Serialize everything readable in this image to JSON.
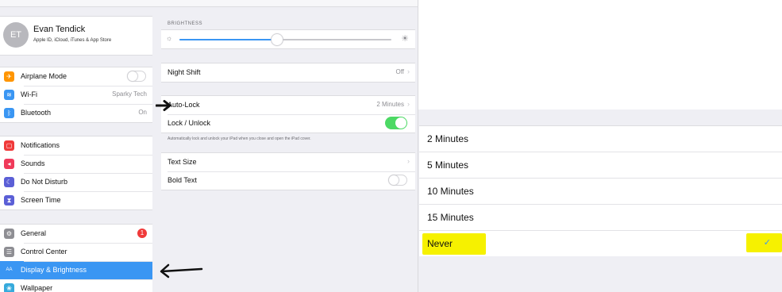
{
  "profile": {
    "initials": "ET",
    "name": "Evan Tendick",
    "subtitle": "Apple ID, iCloud, iTunes & App Store"
  },
  "sidebar": {
    "group1": [
      {
        "label": "Airplane Mode",
        "icon": "airplane-icon",
        "color": "#ff9500",
        "glyph": "✈",
        "control": "toggle-off"
      },
      {
        "label": "Wi-Fi",
        "icon": "wifi-icon",
        "color": "#3a96f3",
        "glyph": "≋",
        "value": "Sparky Tech"
      },
      {
        "label": "Bluetooth",
        "icon": "bluetooth-icon",
        "color": "#3a96f3",
        "glyph": "ᛒ",
        "value": "On"
      }
    ],
    "group2": [
      {
        "label": "Notifications",
        "icon": "notifications-icon",
        "color": "#f03a3a",
        "glyph": "▢"
      },
      {
        "label": "Sounds",
        "icon": "sounds-icon",
        "color": "#f03a5a",
        "glyph": "◂"
      },
      {
        "label": "Do Not Disturb",
        "icon": "moon-icon",
        "color": "#5b5fd6",
        "glyph": "☾"
      },
      {
        "label": "Screen Time",
        "icon": "hourglass-icon",
        "color": "#5b5fd6",
        "glyph": "⧗"
      }
    ],
    "group3": [
      {
        "label": "General",
        "icon": "gear-icon",
        "color": "#8e8e93",
        "glyph": "⚙",
        "badge": "1"
      },
      {
        "label": "Control Center",
        "icon": "control-center-icon",
        "color": "#8e8e93",
        "glyph": "☰"
      },
      {
        "label": "Display & Brightness",
        "icon": "display-icon",
        "color": "#3a96f3",
        "glyph": "AA",
        "selected": true
      },
      {
        "label": "Wallpaper",
        "icon": "wallpaper-icon",
        "color": "#36aadc",
        "glyph": "❀"
      }
    ]
  },
  "pane": {
    "brightness_header": "BRIGHTNESS",
    "brightness_level": 0.46,
    "night_shift_label": "Night Shift",
    "night_shift_value": "Off",
    "auto_lock_label": "Auto-Lock",
    "auto_lock_value": "2 Minutes",
    "lock_unlock_label": "Lock / Unlock",
    "lock_unlock_on": true,
    "lock_footnote": "Automatically lock and unlock your iPad when you close and open the iPad cover.",
    "text_size_label": "Text Size",
    "bold_text_label": "Bold Text",
    "bold_text_on": false
  },
  "autolock": {
    "options": [
      {
        "label": "2 Minutes"
      },
      {
        "label": "5 Minutes"
      },
      {
        "label": "10 Minutes"
      },
      {
        "label": "15 Minutes"
      },
      {
        "label": "Never",
        "selected": true
      }
    ],
    "check_glyph": "✓",
    "highlight_color": "#f6f100"
  }
}
